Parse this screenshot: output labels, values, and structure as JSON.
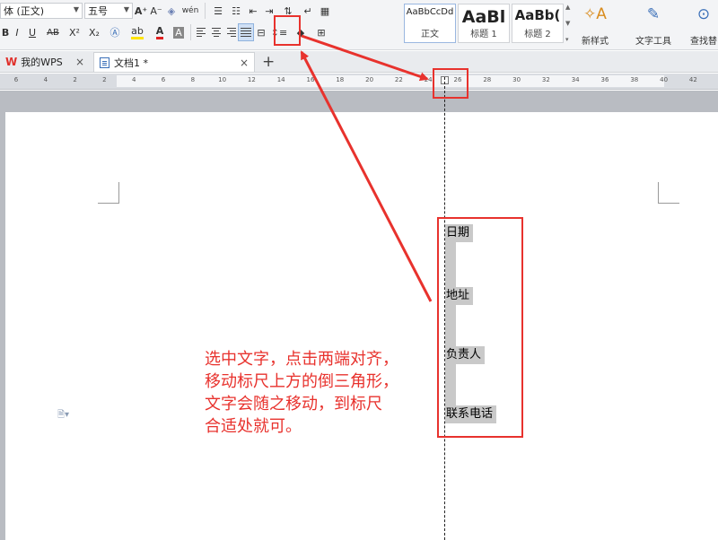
{
  "ribbon": {
    "font_name": "体 (正文)",
    "font_size": "五号",
    "grow_font": "A⁺",
    "shrink_font": "A⁻",
    "pinyin": "wén",
    "bold": "B",
    "italic": "I",
    "underline": "U",
    "strikethrough": "AB",
    "superscript": "X²",
    "subscript": "X₂",
    "font_color": "A",
    "styles": [
      {
        "sample": "AaBbCcDd",
        "label": "正文"
      },
      {
        "sample": "AaBl",
        "label": "标题 1"
      },
      {
        "sample": "AaBb(",
        "label": "标题 2"
      }
    ],
    "new_style": "新样式",
    "text_tools": "文字工具",
    "find_replace": "查找替"
  },
  "tabs": {
    "wps_label": "我的WPS",
    "doc_label": "文档1 *",
    "close": "×",
    "new_tab": "+"
  },
  "ruler": {
    "numbers": [
      "6",
      "4",
      "2",
      "2",
      "4",
      "6",
      "8",
      "10",
      "12",
      "14",
      "16",
      "18",
      "20",
      "22",
      "24",
      "26",
      "28",
      "30",
      "32",
      "34",
      "36",
      "38",
      "40",
      "42"
    ]
  },
  "document": {
    "fields": [
      "日期",
      "地址",
      "负责人",
      "联系电话"
    ]
  },
  "annotation": {
    "lines": [
      "选中文字，点击两端对齐，",
      "移动标尺上方的倒三角形，",
      "文字会随之移动，到标尺",
      "合适处就可。"
    ]
  },
  "colors": {
    "annotation_red": "#e8322d",
    "field_highlight": "#c9c9c9",
    "wps_red": "#e0302b"
  }
}
